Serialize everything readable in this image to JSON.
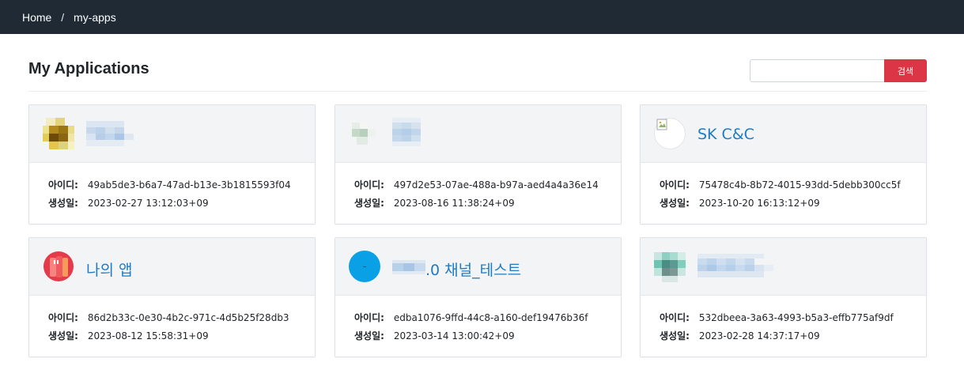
{
  "breadcrumb": {
    "home": "Home",
    "separator": "/",
    "current": "my-apps"
  },
  "page": {
    "title": "My Applications"
  },
  "search": {
    "value": "",
    "button_label": "검색"
  },
  "colors": {
    "topbar": "#1f2a35",
    "accent": "#dc3545",
    "link": "#1e7bc4"
  },
  "labels": {
    "id": "아이디:",
    "created": "생성일:"
  },
  "apps": [
    {
      "name": "",
      "icon": "blurred-logo-icon",
      "id": "49ab5de3-b6a7-47ad-b13e-3b1815593f04",
      "created": "2023-02-27 13:12:03+09"
    },
    {
      "name": "",
      "icon": "blurred-logo-icon",
      "id": "497d2e53-07ae-488a-b97a-aed4a4a36e14",
      "created": "2023-08-16 11:38:24+09"
    },
    {
      "name": "SK C&C",
      "icon": "broken-image-icon",
      "id": "75478c4b-8b72-4015-93dd-5debb300cc5f",
      "created": "2023-10-20 16:13:12+09"
    },
    {
      "name": "나의 앱",
      "icon": "red-app-icon",
      "id": "86d2b33c-0e30-4b2c-971c-4d5b25f28db3",
      "created": "2023-08-12 15:58:31+09"
    },
    {
      "name": ".0 채널_테스트",
      "icon": "blue-circle-icon",
      "id": "edba1076-9ffd-44c8-a160-def19476b36f",
      "created": "2023-03-14 13:00:42+09"
    },
    {
      "name": "",
      "icon": "blurred-logo-icon",
      "id": "532dbeea-3a63-4993-b5a3-effb775af9df",
      "created": "2023-02-28 14:37:17+09"
    }
  ]
}
